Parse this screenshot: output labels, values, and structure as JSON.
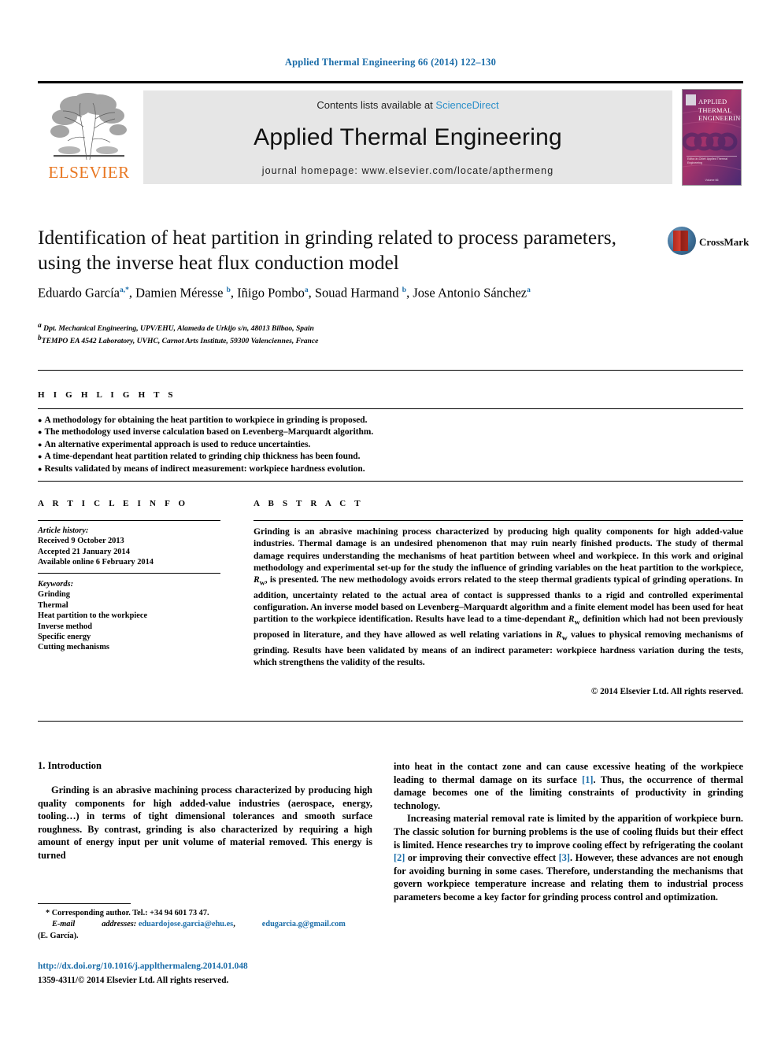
{
  "running_head": "Applied Thermal Engineering 66 (2014) 122–130",
  "masthead": {
    "publisher_name": "ELSEVIER",
    "contents_prefix": "Contents lists available at ",
    "sciencedirect": "ScienceDirect",
    "journal_title": "Applied Thermal Engineering",
    "homepage": "journal homepage: www.elsevier.com/locate/apthermeng",
    "cover": {
      "line1": "APPLIED",
      "line2": "THERMAL",
      "line3": "ENGINEERING",
      "authors_line": "Editor-in-Chief: Applied Thermal Engineering",
      "footer": "Volume 66"
    }
  },
  "article": {
    "title": "Identification of heat partition in grinding related to process parameters, using the inverse heat flux conduction model",
    "authors_html": "Eduardo García<sup class=\"aff\">a,*</sup>, Damien Méresse <sup class=\"aff\">b</sup>, Iñigo Pombo<sup class=\"aff\">a</sup>, Souad Harmand <sup class=\"aff\">b</sup>, Jose Antonio Sánchez<sup class=\"aff\">a</sup>",
    "affiliation_a": "Dpt. Mechanical Engineering, UPV/EHU, Alameda de Urkijo s/n, 48013 Bilbao, Spain",
    "affiliation_b": "TEMPO EA 4542 Laboratory, UVHC, Carnot Arts Institute, 59300 Valenciennes, France",
    "crossmark_label": "CrossMark"
  },
  "highlights": {
    "heading": "H I G H L I G H T S",
    "items": [
      "A methodology for obtaining the heat partition to workpiece in grinding is proposed.",
      "The methodology used inverse calculation based on Levenberg–Marquardt algorithm.",
      "An alternative experimental approach is used to reduce uncertainties.",
      "A time-dependant heat partition related to grinding chip thickness has been found.",
      "Results validated by means of indirect measurement: workpiece hardness evolution."
    ]
  },
  "article_info": {
    "heading": "A R T I C L E   I N F O",
    "history_label": "Article history:",
    "history": [
      "Received 9 October 2013",
      "Accepted 21 January 2014",
      "Available online 6 February 2014"
    ],
    "keywords_label": "Keywords:",
    "keywords": [
      "Grinding",
      "Thermal",
      "Heat partition to the workpiece",
      "Inverse method",
      "Specific energy",
      "Cutting mechanisms"
    ]
  },
  "abstract": {
    "heading": "A B S T R A C T",
    "text_html": "Grinding is an abrasive machining process characterized by producing high quality components for high added-value industries. Thermal damage is an undesired phenomenon that may ruin nearly finished products. The study of thermal damage requires understanding the mechanisms of heat partition between wheel and workpiece. In this work and original methodology and experimental set-up for the study the influence of grinding variables on the heat partition to the workpiece, <i>R</i><sub>w</sub>, is presented. The new methodology avoids errors related to the steep thermal gradients typical of grinding operations. In addition, uncertainty related to the actual area of contact is suppressed thanks to a rigid and controlled experimental configuration. An inverse model based on Levenberg–Marquardt algorithm and a finite element model has been used for heat partition to the workpiece identification. Results have lead to a time-dependant <i>R</i><sub>w</sub> definition which had not been previously proposed in literature, and they have allowed as well relating variations in <i>R</i><sub>w</sub> values to physical removing mechanisms of grinding. Results have been validated by means of an indirect parameter: workpiece hardness variation during the tests, which strengthens the validity of the results.",
    "copyright": "© 2014 Elsevier Ltd. All rights reserved."
  },
  "body": {
    "section_number_title": "1. Introduction",
    "left_paragraph_html": "Grinding is an abrasive machining process characterized by producing high quality components for high added-value industries (aerospace, energy, tooling…) in terms of tight dimensional tolerances and smooth surface roughness. By contrast, grinding is also characterized by requiring a high amount of energy input per unit volume of material removed. This energy is turned",
    "right_paragraph_1_html": "into heat in the contact zone and can cause excessive heating of the workpiece leading to thermal damage on its surface <span class=\"cite\">[1]</span>. Thus, the occurrence of thermal damage becomes one of the limiting constraints of productivity in grinding technology.",
    "right_paragraph_2_html": "Increasing material removal rate is limited by the apparition of workpiece burn. The classic solution for burning problems is the use of cooling fluids but their effect is limited. Hence researches try to improve cooling effect by refrigerating the coolant <span class=\"cite\">[2]</span> or improving their convective effect <span class=\"cite\">[3]</span>. However, these advances are not enough for avoiding burning in some cases. Therefore, understanding the mechanisms that govern workpiece temperature increase and relating them to industrial process parameters become a key factor for grinding process control and optimization."
  },
  "footnotes": {
    "corresponding_html": "* Corresponding author. Tel.: +34 94 601 73 47.",
    "email_label": "E-mail",
    "addresses_label": "addresses:",
    "email_1": "eduardojose.garcia@ehu.es",
    "email_2": "edugarcia.g@gmail.com",
    "email_owner": "(E. García).",
    "doi": "http://dx.doi.org/10.1016/j.applthermaleng.2014.01.048",
    "issn": "1359-4311/© 2014 Elsevier Ltd. All rights reserved."
  },
  "colors": {
    "link_blue": "#1a6ca8",
    "sciencedirect_blue": "#2b8fc9",
    "elsevier_orange": "#e87722"
  }
}
